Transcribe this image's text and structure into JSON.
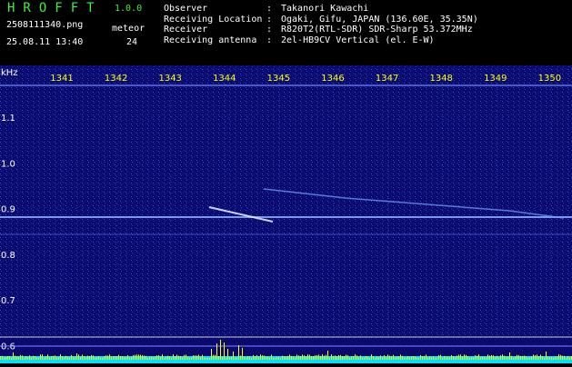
{
  "header": {
    "app_title": "HROFFT",
    "version": "1.0.0",
    "filename": "2508111340.png",
    "datetime": "25.08.11 13:40",
    "meteor_label": "meteor",
    "meteor_count": "24",
    "info": [
      {
        "label": "Observer",
        "sep": ":",
        "value": "Takanori Kawachi"
      },
      {
        "label": "Receiving Location",
        "sep": ":",
        "value": "Ogaki, Gifu, JAPAN (136.60E, 35.35N)"
      },
      {
        "label": "Receiver",
        "sep": ":",
        "value": "R820T2(RTL-SDR) SDR-Sharp 53.372MHz"
      },
      {
        "label": "Receiving antenna",
        "sep": ":",
        "value": "2el-HB9CV Vertical (el. E-W)"
      }
    ]
  },
  "spectrogram": {
    "y_unit": "kHz",
    "time_ticks": [
      "1341",
      "1342",
      "1343",
      "1344",
      "1345",
      "1346",
      "1347",
      "1348",
      "1349",
      "1350"
    ],
    "freq_ticks": [
      "1.1",
      "1.0",
      "0.9",
      "0.8",
      "0.7",
      "0.6"
    ],
    "colors": {
      "background": "#0a0a6e",
      "tick_label": "#ffff00",
      "axis_label": "#ffffff",
      "power_bars": "#ffff00",
      "baseline": "#00e0ff"
    }
  }
}
